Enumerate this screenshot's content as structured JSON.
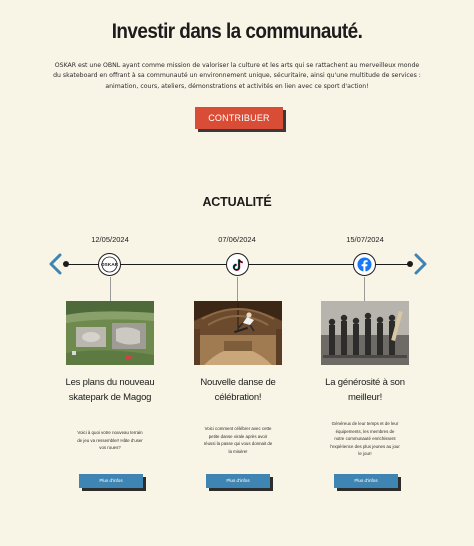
{
  "hero": {
    "title": "Investir dans la communauté.",
    "intro": "OSKAR est une OBNL ayant comme mission de valoriser la culture et les arts qui se rattachent au merveilleux monde du skateboard en offrant à sa communauté un environnement unique, sécuritaire, ainsi qu'une multitude de services : animation, cours, ateliers, démonstrations et activités en lien avec ce sport d'action!",
    "cta_label": "CONTRIBUER"
  },
  "news": {
    "title": "ACTUALITÉ",
    "prev_icon": "chevron-left-icon",
    "next_icon": "chevron-right-icon",
    "items": [
      {
        "date": "12/05/2024",
        "icon": "oskar-logo-icon",
        "logo_text": "OSKAR",
        "title": "Les plans du nouveau skatepark de Magog",
        "text": "Voici à quoi votre nouveau terrain de jeu va ressembler! Hâte d'user vos roues?",
        "button": "Plus d'infos"
      },
      {
        "date": "07/06/2024",
        "icon": "tiktok-icon",
        "title": "Nouvelle danse de célébration!",
        "text": "Voici comment célébrer avec cette petite danse virale après avoir réussi la passe qui vous donnait de la misère!",
        "button": "Plus d'infos"
      },
      {
        "date": "15/07/2024",
        "icon": "facebook-icon",
        "title": "La générosité à son meilleur!",
        "text": "Généreux de leur temps et de leur équipements, les membres de notre communauté enrichissent l'expérience des plus jeunes au jour le jour!",
        "button": "Plus d'infos"
      }
    ]
  },
  "colors": {
    "background": "#f8f5e6",
    "cta": "#d94d36",
    "button": "#3f85b3",
    "arrow": "#3f85b3",
    "facebook": "#1877f2"
  }
}
